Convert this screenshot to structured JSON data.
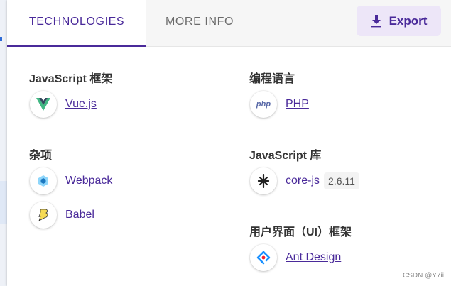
{
  "tabs": [
    {
      "label": "TECHNOLOGIES",
      "active": true
    },
    {
      "label": "MORE INFO",
      "active": false
    }
  ],
  "export": {
    "label": "Export",
    "icon": "download-icon"
  },
  "sections": {
    "js_frameworks": {
      "title": "JavaScript 框架",
      "items": [
        {
          "name": "Vue.js",
          "icon": "vue-icon"
        }
      ]
    },
    "programming_languages": {
      "title": "编程语言",
      "items": [
        {
          "name": "PHP",
          "icon": "php-icon"
        }
      ]
    },
    "miscellaneous": {
      "title": "杂项",
      "items": [
        {
          "name": "Webpack",
          "icon": "webpack-icon"
        },
        {
          "name": "Babel",
          "icon": "babel-icon"
        }
      ]
    },
    "js_libraries": {
      "title": "JavaScript 库",
      "items": [
        {
          "name": "core-js",
          "version": "2.6.11",
          "icon": "core-js-icon"
        }
      ]
    },
    "ui_frameworks": {
      "title": "用户界面（UI）框架",
      "items": [
        {
          "name": "Ant Design",
          "icon": "ant-design-icon"
        }
      ]
    }
  },
  "watermark": "CSDN @Y7ii",
  "colors": {
    "accent": "#4a2a9a",
    "export_bg": "#ede6f8"
  }
}
